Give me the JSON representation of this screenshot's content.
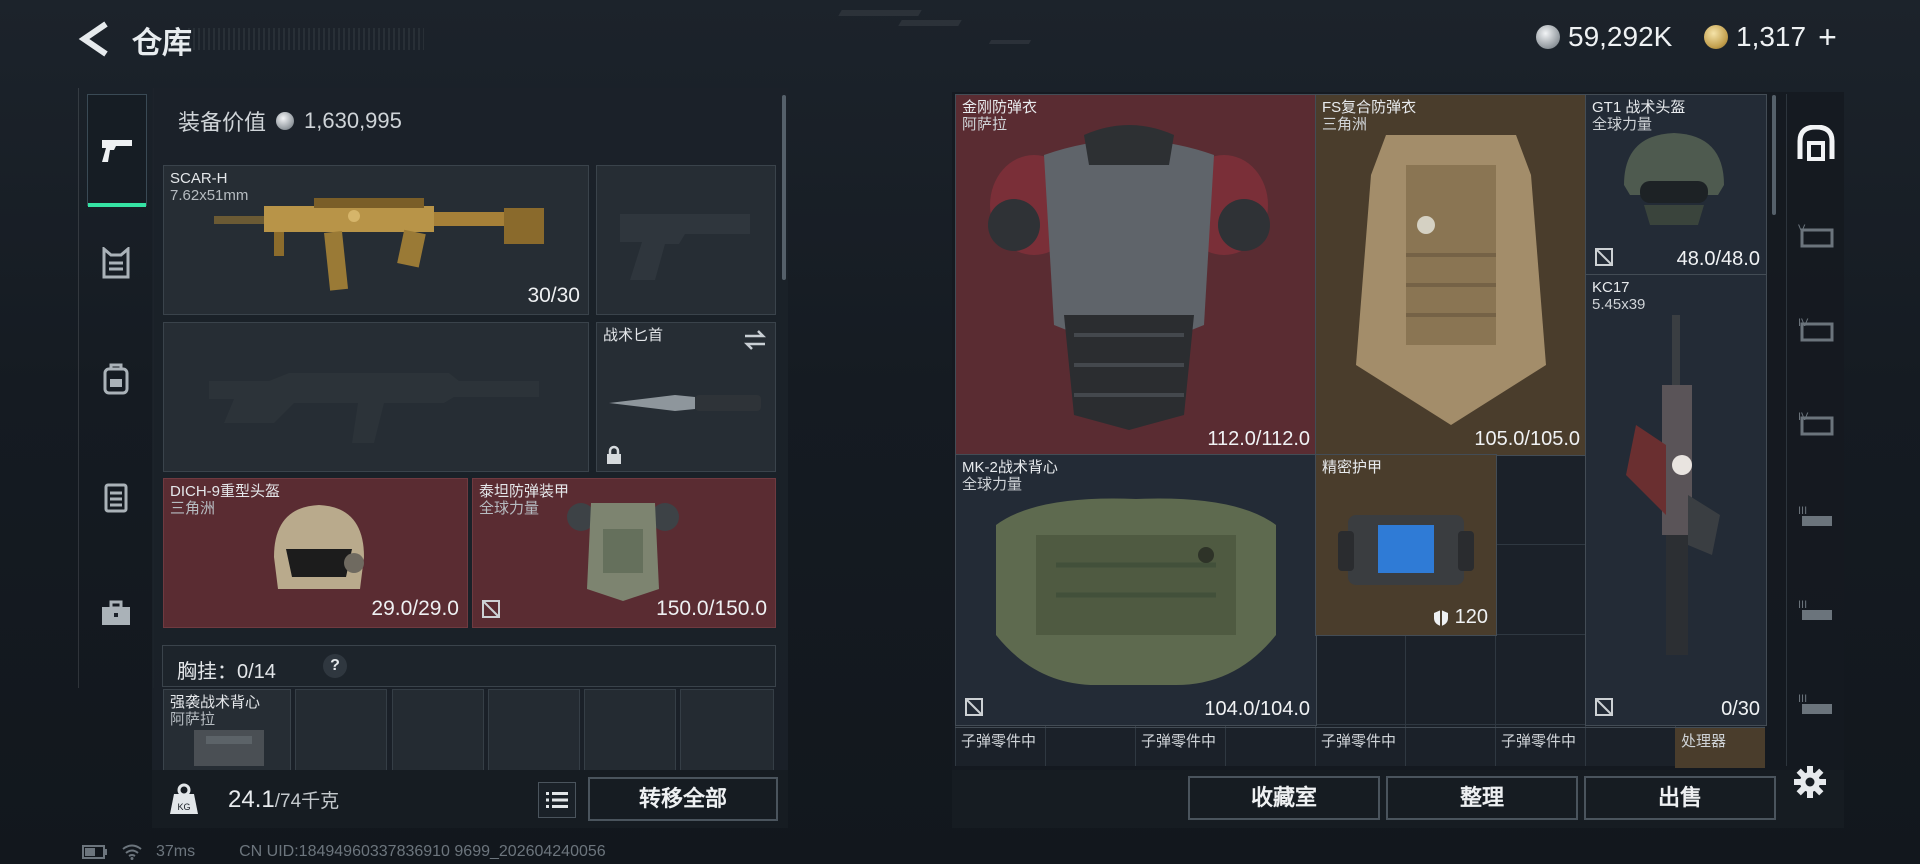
{
  "header": {
    "title": "仓库"
  },
  "currency": {
    "silver": "59,292K",
    "gold": "1,317",
    "plus": "+"
  },
  "sidebar": {
    "items": [
      "weapon-icon",
      "armor-category-icon",
      "backpack-category-icon",
      "chest-rig-icon",
      "case-icon"
    ]
  },
  "loadout": {
    "value_label": "装备价值",
    "value": "1,630,995",
    "primary": {
      "name": "SCAR-H",
      "sub": "7.62x51mm",
      "count": "30/30"
    },
    "melee": {
      "name": "战术匕首"
    },
    "helmet": {
      "name": "DICH-9重型头盔",
      "sub": "三角洲",
      "count": "29.0/29.0"
    },
    "armor": {
      "name": "泰坦防弹装甲",
      "sub": "全球力量",
      "count": "150.0/150.0"
    },
    "chest_rig": {
      "label": "胸挂：",
      "count": "0/14",
      "help": "?"
    },
    "backpack": {
      "name": "强袭战术背心",
      "sub": "阿萨拉"
    },
    "weight": "24.1",
    "weight_max": "/74千克",
    "transfer_all": "转移全部"
  },
  "stash": {
    "items": [
      {
        "name": "金刚防弹衣",
        "sub": "阿萨拉",
        "count": "112.0/112.0"
      },
      {
        "name": "FS复合防弹衣",
        "sub": "三角洲",
        "count": "105.0/105.0"
      },
      {
        "name": "GT1 战术头盔",
        "sub": "全球力量",
        "count": "48.0/48.0"
      },
      {
        "name": "KC17",
        "sub": "5.45x39",
        "count": "0/30"
      },
      {
        "name": "MK-2战术背心",
        "sub": "全球力量",
        "count": "104.0/104.0"
      },
      {
        "name": "精密护甲",
        "count": "120"
      }
    ],
    "ammo": [
      "子弹零件中",
      "子弹零件中",
      "子弹零件中",
      "子弹零件中",
      "处理器"
    ],
    "buttons": {
      "collection": "收藏室",
      "sort": "整理",
      "sell": "出售"
    }
  },
  "filters": [
    "all-items-icon",
    "tier-5-armor-icon",
    "tier-4-armor-icon",
    "tier-4-armor-icon-2",
    "tier-3-armor-icon",
    "tier-3-armor-icon-2",
    "tier-3-armor-icon-3"
  ],
  "status": {
    "ping": "37ms",
    "uid": "CN UID:18494960337836910 9699_202604240056"
  },
  "colors": {
    "accent": "#35e3a4",
    "red_rarity": "#5a2c32",
    "brown_rarity": "#4a3d2c",
    "panel": "#1b2129"
  }
}
